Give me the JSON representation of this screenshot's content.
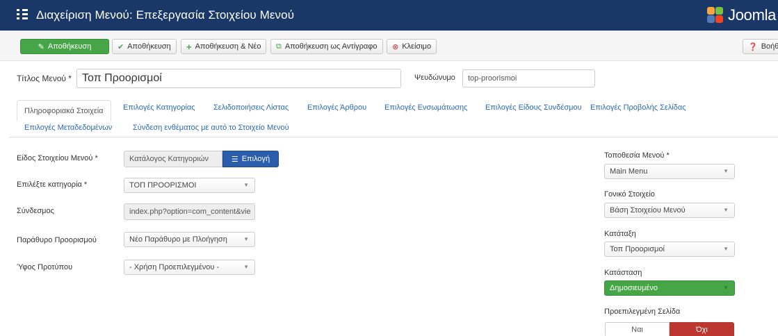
{
  "header": {
    "title": "Διαχείριση Μενού: Επεξεργασία Στοιχείου Μενού",
    "brand": "Joomla",
    "colors": {
      "bar": "#1a3867"
    }
  },
  "toolbar": {
    "save_primary": "Αποθήκευση",
    "save": "Αποθήκευση",
    "save_new": "Αποθήκευση & Νέο",
    "save_copy": "Αποθήκευση ως Αντίγραφο",
    "close": "Κλείσιμο",
    "help": "Βοήθ"
  },
  "form": {
    "title_label": "Τίτλος Μενού *",
    "title_value": "Τοπ Προορισμοί",
    "alias_label": "Ψευδώνυμο",
    "alias_value": "top-proorismoi"
  },
  "tabs": [
    "Πληροφοριακά Στοιχεία",
    "Επιλογές Κατηγορίας",
    "Σελιδοποιήσεις Λίστας",
    "Επιλογές Άρθρου",
    "Επιλογές Ενσωμάτωσης",
    "Επιλογές Είδους Συνδέσμου",
    "Επιλογές Προβολής Σελίδας",
    "Επιλογές Μεταδεδομένων",
    "Σύνδεση ενθέματος με αυτό το Στοιχείο Μενού"
  ],
  "details": {
    "type_label": "Είδος Στοιχείου Μενού *",
    "type_value": "Κατάλογος Κατηγοριών",
    "type_button": "Επιλογή",
    "category_label": "Επιλέξτε κατηγορία *",
    "category_value": "ΤΟΠ ΠΡΟΟΡΙΣΜΟΙ",
    "link_label": "Σύνδεσμος",
    "link_value": "index.php?option=com_content&vie",
    "target_label": "Παράθυρο Προορισμού",
    "target_value": "Νέο Παράθυρο με Πλοήγηση",
    "style_label": "Ύφος Προτύπου",
    "style_value": "- Χρήση Προεπιλεγμένου -"
  },
  "sidebar": {
    "menu_label": "Τοποθεσία Μενού *",
    "menu_value": "Main Menu",
    "parent_label": "Γονικό Στοιχείο",
    "parent_value": "Βάση Στοιχείου Μενού",
    "order_label": "Κατάταξη",
    "order_value": "Τοπ Προορισμοί",
    "status_label": "Κατάσταση",
    "status_value": "Δημοσιευμένο",
    "home_label": "Προεπιλεγμένη Σελίδα",
    "home_yes": "Ναι",
    "home_no": "Όχι"
  }
}
